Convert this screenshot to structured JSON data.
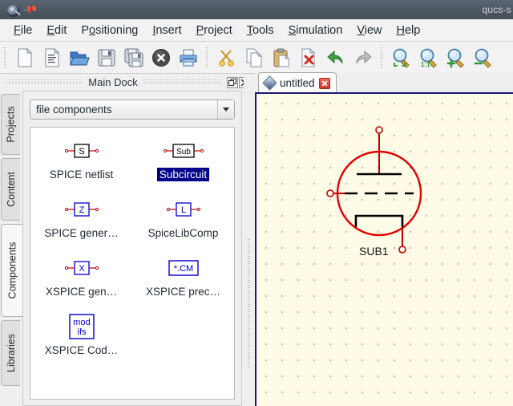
{
  "window": {
    "title": "qucs-s",
    "app_icon": "app-icon",
    "pin_icon": "pin-icon"
  },
  "menubar": {
    "items": [
      {
        "label": "File",
        "mnemonic_index": 0
      },
      {
        "label": "Edit",
        "mnemonic_index": 0
      },
      {
        "label": "Positioning",
        "mnemonic_index": 1
      },
      {
        "label": "Insert",
        "mnemonic_index": 0
      },
      {
        "label": "Project",
        "mnemonic_index": 0
      },
      {
        "label": "Tools",
        "mnemonic_index": 0
      },
      {
        "label": "Simulation",
        "mnemonic_index": 0
      },
      {
        "label": "View",
        "mnemonic_index": 0
      },
      {
        "label": "Help",
        "mnemonic_index": 0
      }
    ]
  },
  "toolbar": {
    "groups": [
      {
        "buttons": [
          {
            "name": "new-document-button",
            "icon": "new-document-icon"
          },
          {
            "name": "new-text-document-button",
            "icon": "new-text-document-icon"
          },
          {
            "name": "open-document-button",
            "icon": "open-folder-icon"
          },
          {
            "name": "save-button",
            "icon": "floppy-save-icon"
          },
          {
            "name": "save-all-button",
            "icon": "floppy-save-all-icon"
          },
          {
            "name": "close-document-button",
            "icon": "close-circle-icon"
          },
          {
            "name": "print-button",
            "icon": "printer-icon"
          }
        ]
      },
      {
        "buttons": [
          {
            "name": "cut-button",
            "icon": "scissors-icon"
          },
          {
            "name": "copy-button",
            "icon": "copy-pages-icon"
          },
          {
            "name": "paste-button",
            "icon": "clipboard-paste-icon"
          },
          {
            "name": "delete-button",
            "icon": "document-delete-icon"
          },
          {
            "name": "undo-button",
            "icon": "undo-arrow-icon"
          },
          {
            "name": "redo-button",
            "icon": "redo-arrow-icon"
          }
        ]
      },
      {
        "buttons": [
          {
            "name": "zoom-fit-button",
            "icon": "zoom-fit-icon"
          },
          {
            "name": "zoom-original-button",
            "icon": "zoom-one-to-one-icon"
          },
          {
            "name": "zoom-in-button",
            "icon": "zoom-in-icon"
          },
          {
            "name": "zoom-out-button",
            "icon": "zoom-out-icon"
          }
        ]
      }
    ]
  },
  "dock": {
    "title": "Main Dock",
    "float_button_icon": "restore-window-icon",
    "close_button_icon": "close-x-icon",
    "side_tabs": [
      {
        "label": "Projects",
        "active": false
      },
      {
        "label": "Content",
        "active": false
      },
      {
        "label": "Components",
        "active": true
      },
      {
        "label": "Libraries",
        "active": false
      }
    ],
    "category_combo": {
      "value": "file components",
      "arrow_icon": "chevron-down-icon"
    },
    "components": [
      {
        "label": "SPICE netlist",
        "symbol": "S",
        "symbol_color": "#000000",
        "selected": false
      },
      {
        "label": "Subcircuit",
        "symbol": "Sub",
        "symbol_color": "#000000",
        "selected": true
      },
      {
        "label": "SPICE gener…",
        "symbol": "Z",
        "symbol_color": "#0000cd",
        "selected": false
      },
      {
        "label": "SpiceLibComp",
        "symbol": "L",
        "symbol_color": "#0000cd",
        "selected": false
      },
      {
        "label": "XSPICE gen…",
        "symbol": "X",
        "symbol_color": "#0000cd",
        "selected": false
      },
      {
        "label": "XSPICE prec…",
        "symbol": "*.CM",
        "symbol_color": "#0000cd",
        "selected": false,
        "no_pins": true
      },
      {
        "label": "XSPICE Cod…",
        "symbol": "mod\nifs",
        "symbol_color": "#0000cd",
        "selected": false,
        "no_pins": true,
        "two_line": true
      }
    ]
  },
  "document_tabs": [
    {
      "label": "untitled",
      "icon": "schematic-diamond-icon",
      "close_icon": "tab-close-icon",
      "active": true
    }
  ],
  "canvas": {
    "background_color": "#fffbe6",
    "grid_color": "#262626",
    "grid_spacing_px": 20,
    "border_color": "#1a1a7a",
    "component": {
      "name": "SUB1",
      "symbol_type": "vacuum-tube-triode",
      "outline_color": "#e00000",
      "electrode_color": "#000000",
      "wire_color": "#b00000",
      "terminals": 3
    }
  }
}
